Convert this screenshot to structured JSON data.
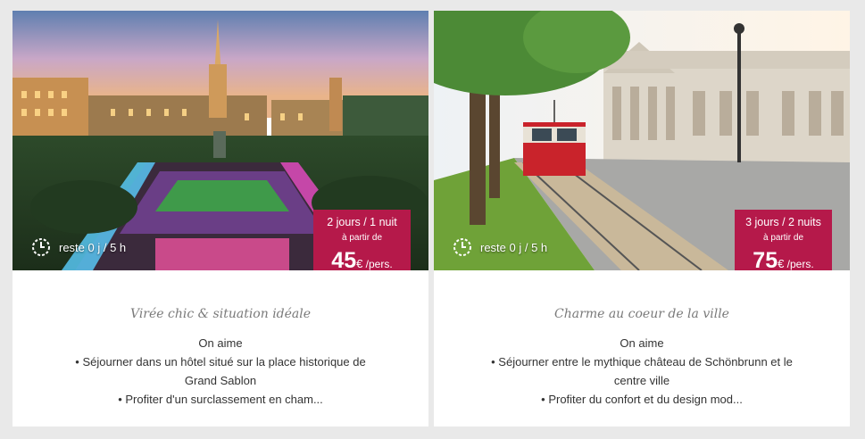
{
  "cards": [
    {
      "timer": "reste 0 j / 5 h",
      "duration": "2 jours / 1 nuit",
      "from_label": "à partir de",
      "price": "45",
      "currency": "€",
      "unit": " /pers.",
      "tagline": "Virée chic & situation idéale",
      "desc_title": "On aime",
      "desc_lines": [
        "• Séjourner dans un hôtel situé sur la place historique de",
        "Grand Sablon",
        "• Profiter d'un surclassement en cham..."
      ]
    },
    {
      "timer": "reste 0 j / 5 h",
      "duration": "3 jours / 2 nuits",
      "from_label": "à partir de",
      "price": "75",
      "currency": "€",
      "unit": " /pers.",
      "tagline": "Charme au coeur de la ville",
      "desc_title": "On aime",
      "desc_lines": [
        "• Séjourner entre le mythique château de Schönbrunn et le",
        "centre ville",
        "• Profiter du confort et du design mod..."
      ]
    }
  ],
  "colors": {
    "badge": "#b5194a",
    "page_bg": "#e9e9e9"
  }
}
